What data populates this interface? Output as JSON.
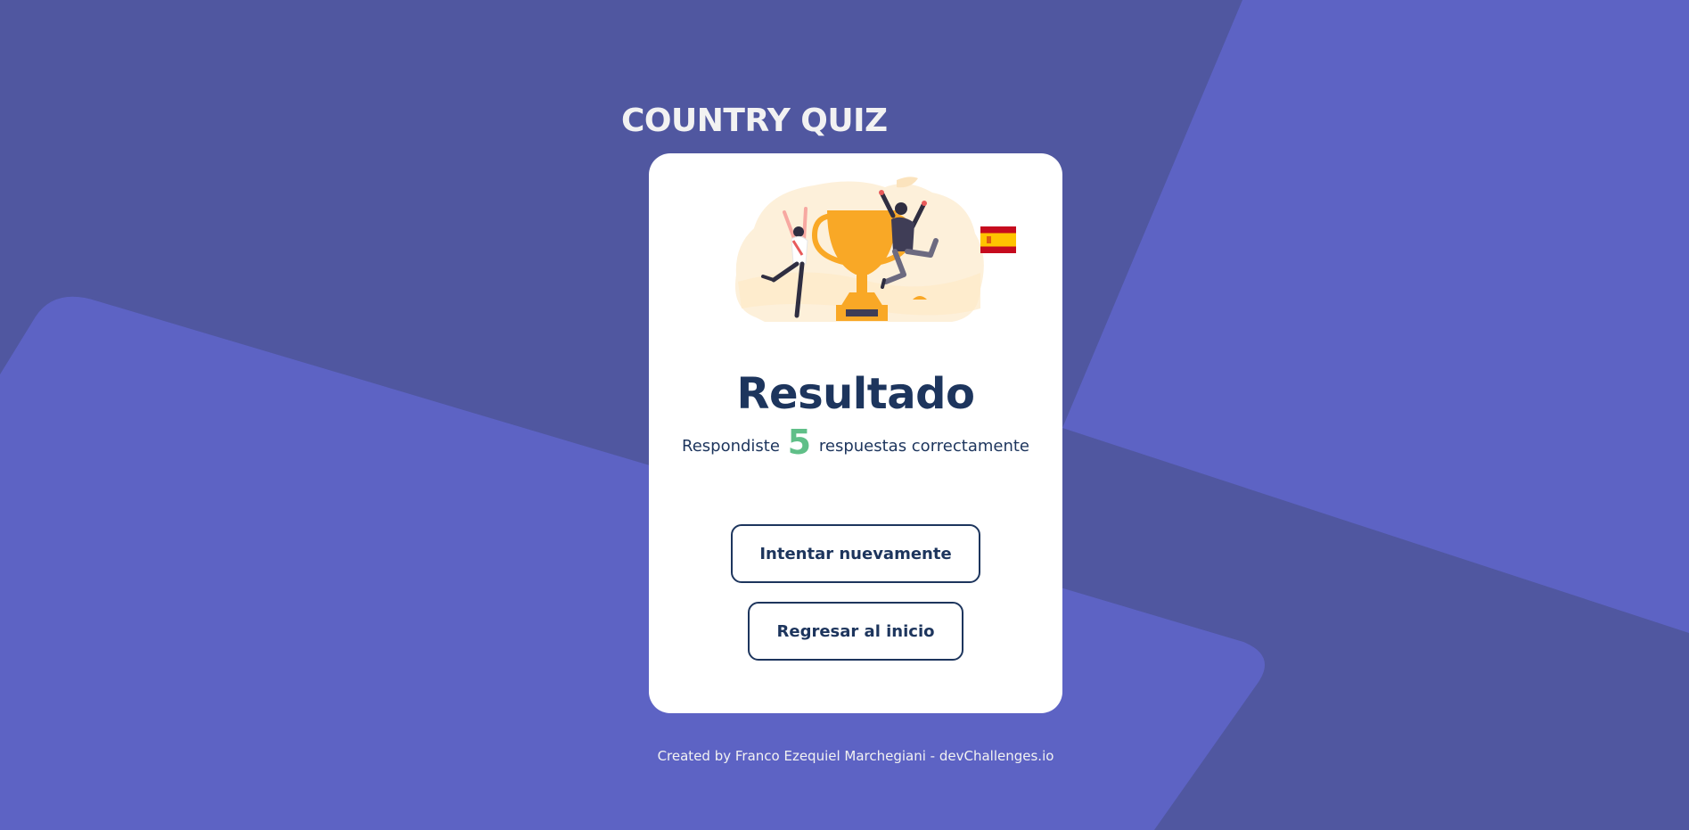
{
  "app": {
    "title": "COUNTRY QUIZ"
  },
  "result": {
    "title": "Resultado",
    "prefix": "Respondiste",
    "score": "5",
    "suffix": "respuestas correctamente",
    "illustration_icon": "trophy-celebration-illustration",
    "flag_icon": "spain-flag-icon"
  },
  "buttons": {
    "retry_label": "Intentar nuevamente",
    "home_label": "Regresar al inicio"
  },
  "footer": {
    "credit": "Created by Franco Ezequiel Marchegiani - devChallenges.io"
  },
  "colors": {
    "background": "#5057a0",
    "background_shape": "#5d63c4",
    "card": "#ffffff",
    "text_dark": "#1d355d",
    "score_green": "#60bf88",
    "trophy_orange": "#f9a826",
    "title_light": "#f2f2f2"
  }
}
